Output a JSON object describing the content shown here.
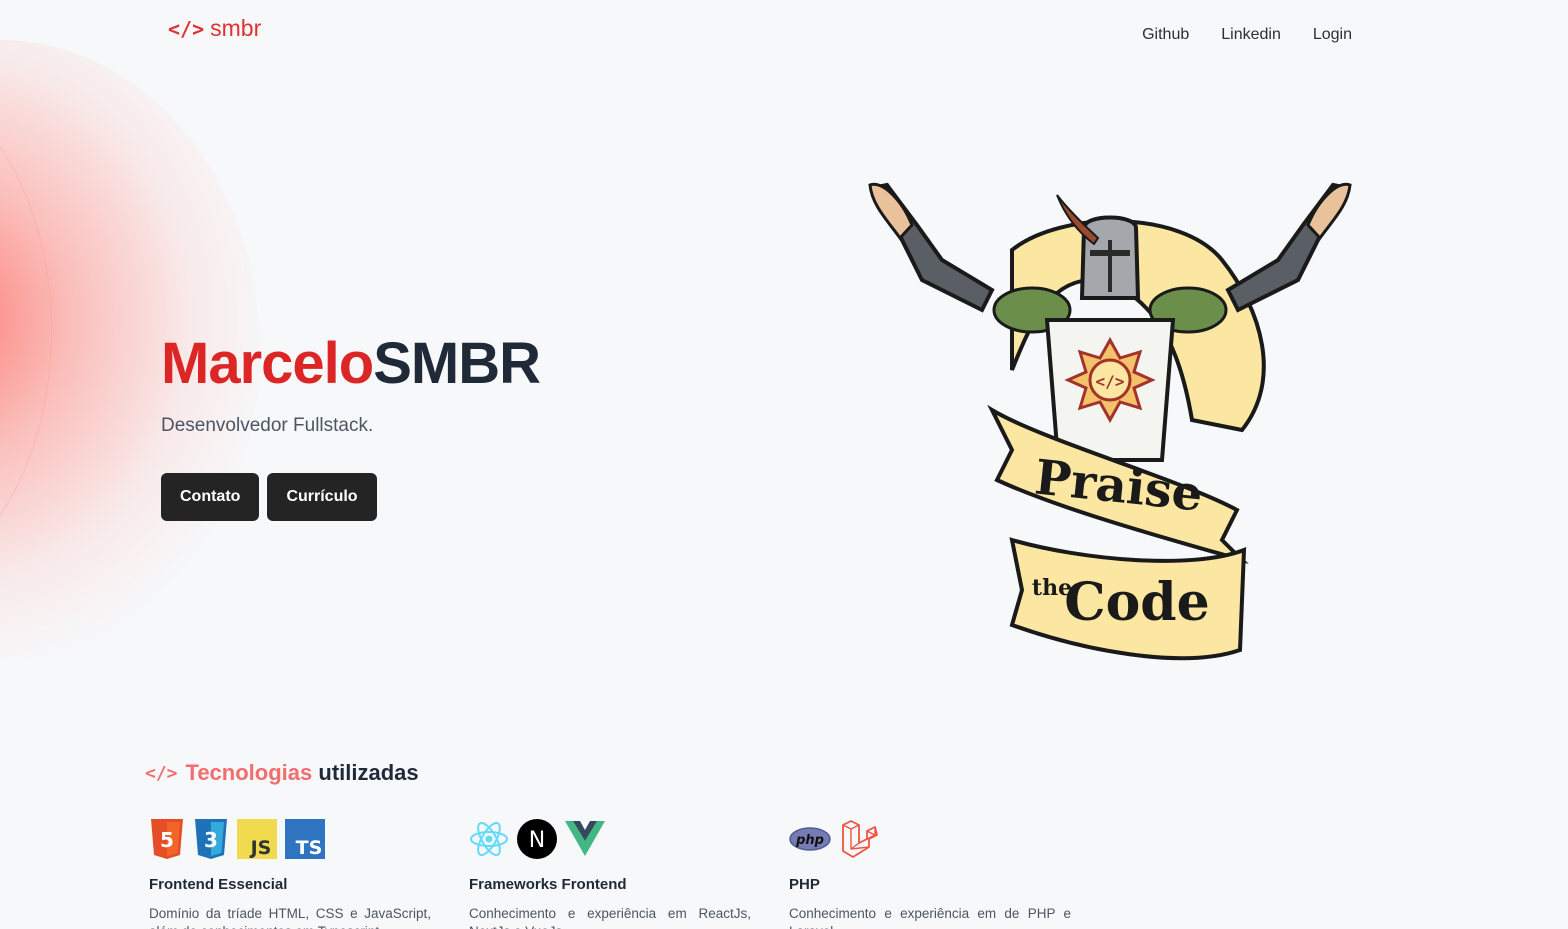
{
  "header": {
    "logo_symbol": "</>",
    "logo_text": "smbr",
    "nav": [
      {
        "label": "Github"
      },
      {
        "label": "Linkedin"
      },
      {
        "label": "Login"
      }
    ]
  },
  "hero": {
    "first_name": "Marcelo",
    "last_name": "SMBR",
    "subtitle": "Desenvolvedor Fullstack.",
    "buttons": [
      {
        "label": "Contato"
      },
      {
        "label": "Currículo"
      }
    ],
    "illustration": {
      "banner_top": "Praise",
      "banner_small": "the",
      "banner_bottom": "Code",
      "emblem": "</>"
    }
  },
  "technologies": {
    "title_symbol": "</>",
    "title_accent": "Tecnologias",
    "title_rest": "utilizadas",
    "groups": [
      {
        "title": "Frontend Essencial",
        "description": "Domínio da tríade HTML, CSS e JavaScript, além de conhecimentos em Typescript.",
        "icons": [
          {
            "name": "html5-icon",
            "label": "5",
            "color": "#e44d26"
          },
          {
            "name": "css3-icon",
            "label": "3",
            "color": "#1f72b8"
          },
          {
            "name": "javascript-icon",
            "label": "JS",
            "color": "#f0db4f"
          },
          {
            "name": "typescript-icon",
            "label": "TS",
            "color": "#2f74c0"
          }
        ]
      },
      {
        "title": "Frameworks Frontend",
        "description": "Conhecimento e experiência em ReactJs, NextJs e VueJs.",
        "icons": [
          {
            "name": "react-icon",
            "label": "",
            "color": "#61dafb"
          },
          {
            "name": "nextjs-icon",
            "label": "N",
            "color": "#000000"
          },
          {
            "name": "vue-icon",
            "label": "",
            "color": "#41b883"
          }
        ]
      },
      {
        "title": "PHP",
        "description": "Conhecimento e experiência em de PHP e Laravel.",
        "icons": [
          {
            "name": "php-icon",
            "label": "php",
            "color": "#777bb3"
          },
          {
            "name": "laravel-icon",
            "label": "",
            "color": "#f05340"
          }
        ]
      }
    ]
  },
  "colors": {
    "accent": "#dc2626",
    "accent_light": "#f26d6d",
    "button_bg": "#242424",
    "page_bg": "#f7f8fa"
  }
}
